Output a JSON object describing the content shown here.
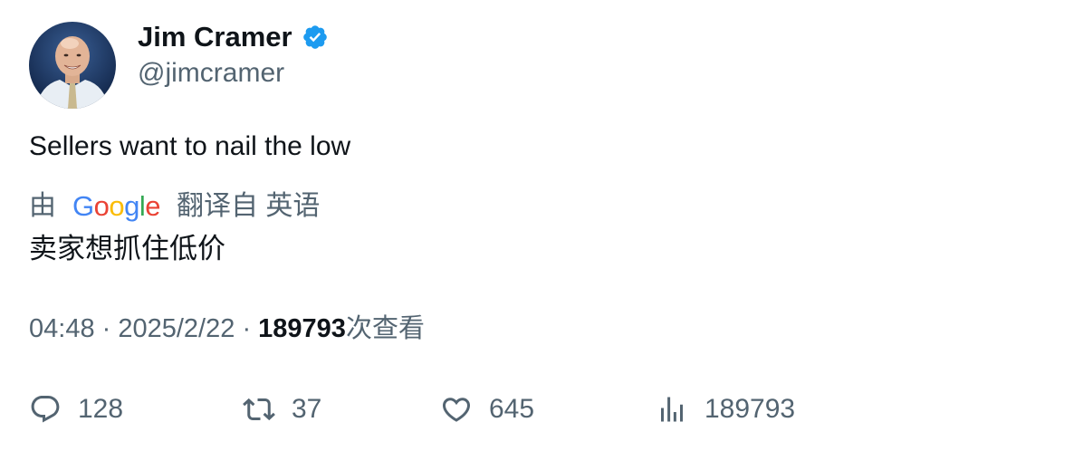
{
  "author": {
    "name": "Jim Cramer",
    "handle": "@jimcramer",
    "verified_color": "#1d9bf0"
  },
  "tweet": {
    "text": "Sellers want to nail the low"
  },
  "translation": {
    "prefix": "由",
    "provider": "Google",
    "suffix": "翻译自 英语",
    "text": "卖家想抓住低价"
  },
  "meta": {
    "time": "04:48",
    "separator": "·",
    "date": "2025/2/22",
    "views_number": "189793",
    "views_label": "次查看"
  },
  "actions": {
    "replies": "128",
    "retweets": "37",
    "likes": "645",
    "views": "189793"
  },
  "icons": {
    "reply": "reply-icon",
    "retweet": "retweet-icon",
    "like": "heart-icon",
    "views": "bar-chart-icon"
  }
}
